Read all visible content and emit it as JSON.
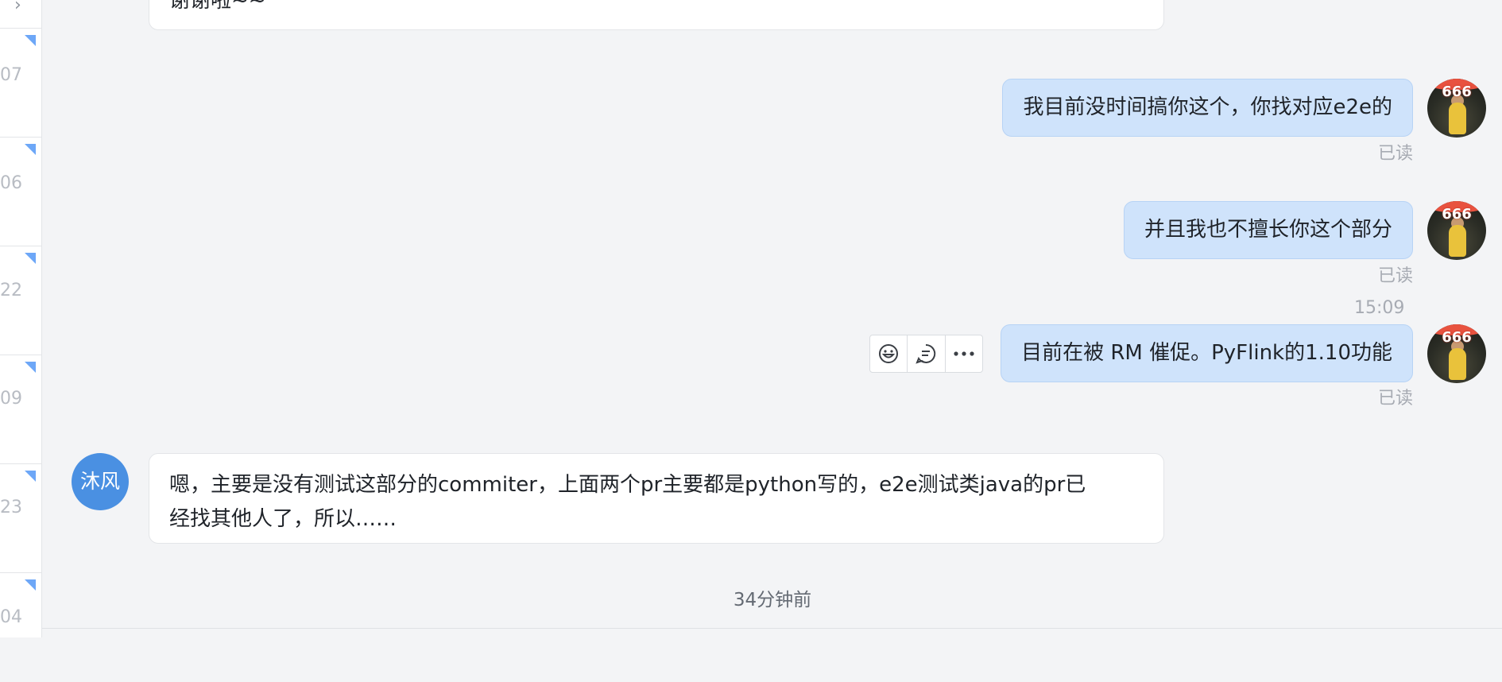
{
  "sidebar_strip": {
    "chevron": "chevron-right-icon",
    "items": [
      {
        "num": "07"
      },
      {
        "num": "06"
      },
      {
        "num": "22"
      },
      {
        "num": "09"
      },
      {
        "num": "23"
      },
      {
        "num": "04"
      }
    ]
  },
  "messages": [
    {
      "text": "谢谢啦~~"
    },
    {
      "text": "我目前没时间搞你这个，你找对应e2e的",
      "status": "已读"
    },
    {
      "text": "并且我也不擅长你这个部分",
      "status": "已读"
    },
    {
      "time": "15:09",
      "text": "目前在被 RM 催促。PyFlink的1.10功能",
      "status": "已读"
    },
    {
      "sender": "沐风",
      "text_line1": "嗯，主要是没有测试这部分的commiter，上面两个pr主要都是python写的，e2e测试类java的pr已",
      "text_line2": "经找其他人了，所以……"
    }
  ],
  "actions": {
    "emoji": "emoji-icon",
    "reply": "reply-icon",
    "more": "more-icon"
  },
  "footer_time": "34分钟前",
  "colors": {
    "accent": "#4a90e2",
    "out_bubble": "#cfe3fb"
  }
}
